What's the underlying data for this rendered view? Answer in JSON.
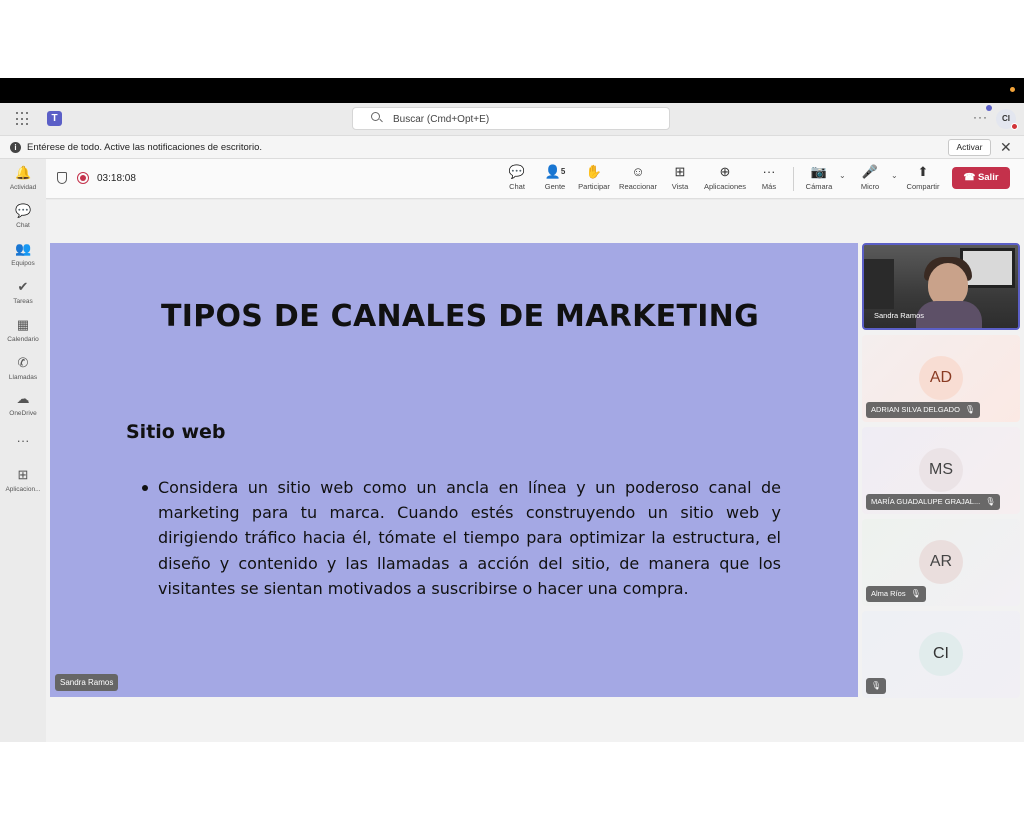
{
  "titlebar": {
    "search_placeholder": "Buscar (Cmd+Opt+E)",
    "more": "···",
    "user_initials": "CI"
  },
  "notification": {
    "message": "Entérese de todo. Active las notificaciones de escritorio.",
    "activate_label": "Activar",
    "close_glyph": "✕"
  },
  "rail": {
    "items": [
      {
        "label": "Actividad",
        "glyph": "🔔"
      },
      {
        "label": "Chat",
        "glyph": "💬"
      },
      {
        "label": "Equipos",
        "glyph": "👥"
      },
      {
        "label": "Tareas",
        "glyph": "✔"
      },
      {
        "label": "Calendario",
        "glyph": "▦"
      },
      {
        "label": "Llamadas",
        "glyph": "✆"
      },
      {
        "label": "OneDrive",
        "glyph": "☁"
      },
      {
        "label": "Aplicacion...",
        "glyph": "⊞"
      }
    ],
    "more": "···"
  },
  "meeting": {
    "timer": "03:18:08",
    "controls": [
      {
        "label": "Chat",
        "glyph": "💬"
      },
      {
        "label": "Gente",
        "glyph": "👤",
        "count": "5"
      },
      {
        "label": "Participar",
        "glyph": "✋"
      },
      {
        "label": "Reaccionar",
        "glyph": "☺"
      },
      {
        "label": "Vista",
        "glyph": "⊞"
      },
      {
        "label": "Aplicaciones",
        "glyph": "⊕"
      },
      {
        "label": "Más",
        "glyph": "···"
      },
      {
        "label": "Cámara",
        "glyph": "📷"
      },
      {
        "label": "Micro",
        "glyph": "🎤"
      },
      {
        "label": "Compartir",
        "glyph": "⬆"
      }
    ],
    "leave_label": "Salir",
    "leave_glyph": "☎"
  },
  "slide": {
    "title": "TIPOS DE CANALES DE MARKETING",
    "heading": "Sitio web",
    "bullet": "Considera un sitio web como un ancla en línea y un poderoso canal de marketing para tu marca. Cuando estés construyendo un sitio web y dirigiendo tráfico hacia él, tómate el tiempo para optimizar la estructura, el diseño y contenido y las llamadas a acción del sitio, de manera que los visitantes se sientan motivados a suscribirse o hacer una compra."
  },
  "presenter": "Sandra Ramos",
  "participants": [
    {
      "name": "Sandra Ramos"
    },
    {
      "initials": "AD",
      "name": "ADRIAN SILVA DELGADO",
      "mic": "🎙"
    },
    {
      "initials": "MS",
      "name": "MARÍA GUADALUPE GRAJAL...",
      "mic": "🎙"
    },
    {
      "initials": "AR",
      "name": "Alma Ríos",
      "mic": "🎙"
    },
    {
      "initials": "CI",
      "name": "",
      "mic": "🎙"
    }
  ],
  "colors": {
    "accent": "#5b5fc7",
    "leave": "#c4314b",
    "slide_bg": "#a4a8e4"
  }
}
